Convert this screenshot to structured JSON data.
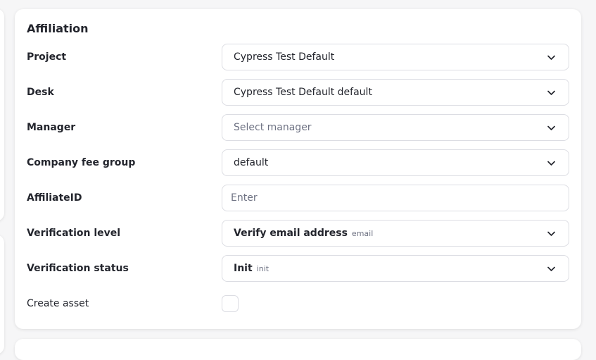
{
  "affiliation": {
    "title": "Affiliation",
    "fields": {
      "project": {
        "label": "Project",
        "value": "Cypress Test Default"
      },
      "desk": {
        "label": "Desk",
        "value": "Cypress Test Default default"
      },
      "manager": {
        "label": "Manager",
        "placeholder": "Select manager"
      },
      "fee_group": {
        "label": "Company fee group",
        "value": "default"
      },
      "affiliate_id": {
        "label": "AffiliateID",
        "placeholder": "Enter"
      },
      "verification_level": {
        "label": "Verification level",
        "value": "Verify email address",
        "sub": "email"
      },
      "verification_status": {
        "label": "Verification status",
        "value": "Init",
        "sub": "init"
      },
      "create_asset": {
        "label": "Create asset",
        "checked": false
      }
    }
  },
  "icons": {
    "dropdown": "chevron-down-icon"
  },
  "colors": {
    "label_text": "#23252d",
    "muted_text": "#6e7283",
    "border": "#dcdde3",
    "background": "#f6f6f7",
    "card": "#ffffff"
  }
}
